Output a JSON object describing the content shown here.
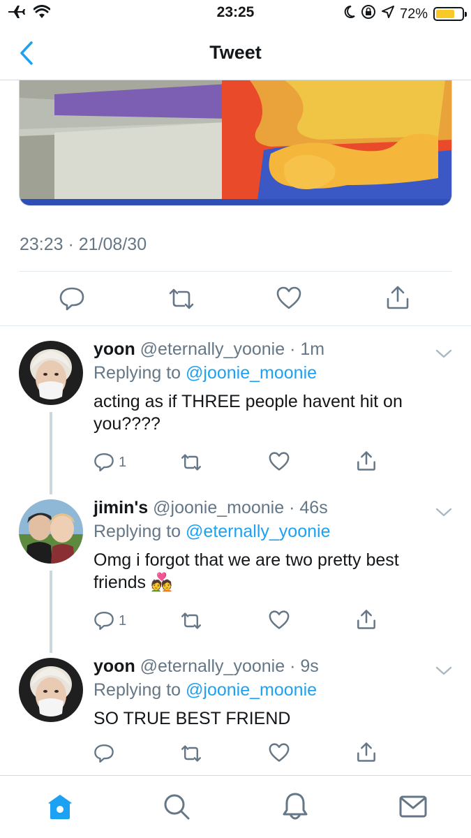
{
  "status_bar": {
    "time": "23:25",
    "battery": "72%",
    "battery_level": 0.72,
    "colors": {
      "battery_fill": "#f8c927"
    }
  },
  "nav": {
    "title": "Tweet",
    "back_icon": "chevron-left-icon"
  },
  "tweet": {
    "timestamp": "23:23 · 21/08/30",
    "actions": [
      "reply-icon",
      "retweet-icon",
      "like-icon",
      "share-icon"
    ]
  },
  "replies": [
    {
      "name": "yoon",
      "handle": "@eternally_yoonie",
      "time": "· 1m",
      "replying_prefix": "Replying to",
      "replying_to": "@joonie_moonie",
      "text": "acting as if THREE people havent hit on you????",
      "reply_count": "1"
    },
    {
      "name": "jimin's",
      "handle": "@joonie_moonie",
      "time": "· 46s",
      "replying_prefix": "Replying to",
      "replying_to": "@eternally_yoonie",
      "text": "Omg i forgot that we are two pretty best friends",
      "emoji": "💑",
      "reply_count": "1"
    },
    {
      "name": "yoon",
      "handle": "@eternally_yoonie",
      "time": "· 9s",
      "replying_prefix": "Replying to",
      "replying_to": "@joonie_moonie",
      "text": "SO TRUE BEST FRIEND",
      "reply_count": ""
    }
  ],
  "tab_bar": {
    "items": [
      "home-icon",
      "search-icon",
      "notifications-icon",
      "messages-icon"
    ],
    "active": "home-icon",
    "colors": {
      "active": "#1da1f2",
      "inactive": "#657786"
    }
  }
}
